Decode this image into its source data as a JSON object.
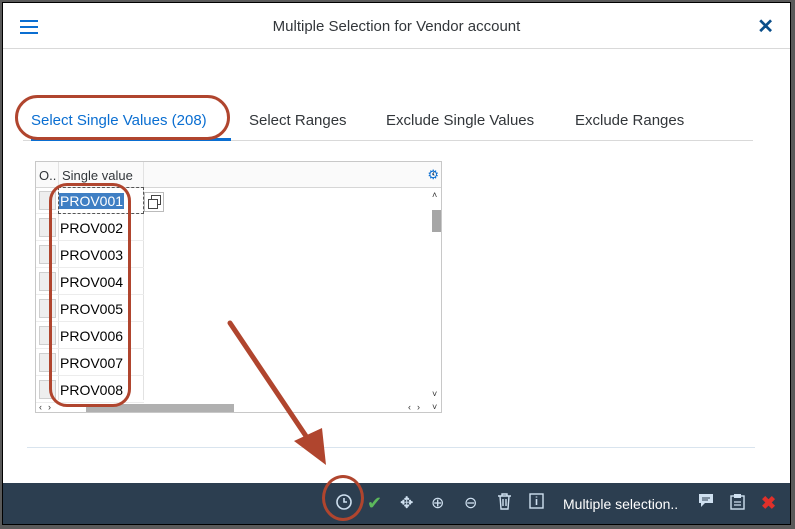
{
  "dialog": {
    "title": "Multiple Selection for Vendor account"
  },
  "tabs": [
    {
      "label": "Select Single Values (208)",
      "active": true
    },
    {
      "label": "Select Ranges",
      "active": false
    },
    {
      "label": "Exclude Single Values",
      "active": false
    },
    {
      "label": "Exclude Ranges",
      "active": false
    }
  ],
  "grid": {
    "col_option": "O..",
    "col_single_value": "Single value",
    "rows": [
      "PROV001",
      "PROV002",
      "PROV003",
      "PROV004",
      "PROV005",
      "PROV006",
      "PROV007",
      "PROV008"
    ]
  },
  "toolbar": {
    "multiple_selection_label": "Multiple selection.."
  },
  "colors": {
    "accent": "#0a6ed1",
    "annotation": "#b0452e",
    "toolbar_bg": "#2c3e50",
    "check_green": "#5cb85c",
    "delete_red": "#e0302a"
  },
  "icons": [
    "menu-icon",
    "close-icon",
    "settings-icon",
    "copy-icon",
    "clock-icon",
    "check-icon",
    "move-icon",
    "add-icon",
    "remove-icon",
    "trash-icon",
    "info-icon",
    "comment-icon",
    "clipboard-icon",
    "cancel-icon"
  ]
}
